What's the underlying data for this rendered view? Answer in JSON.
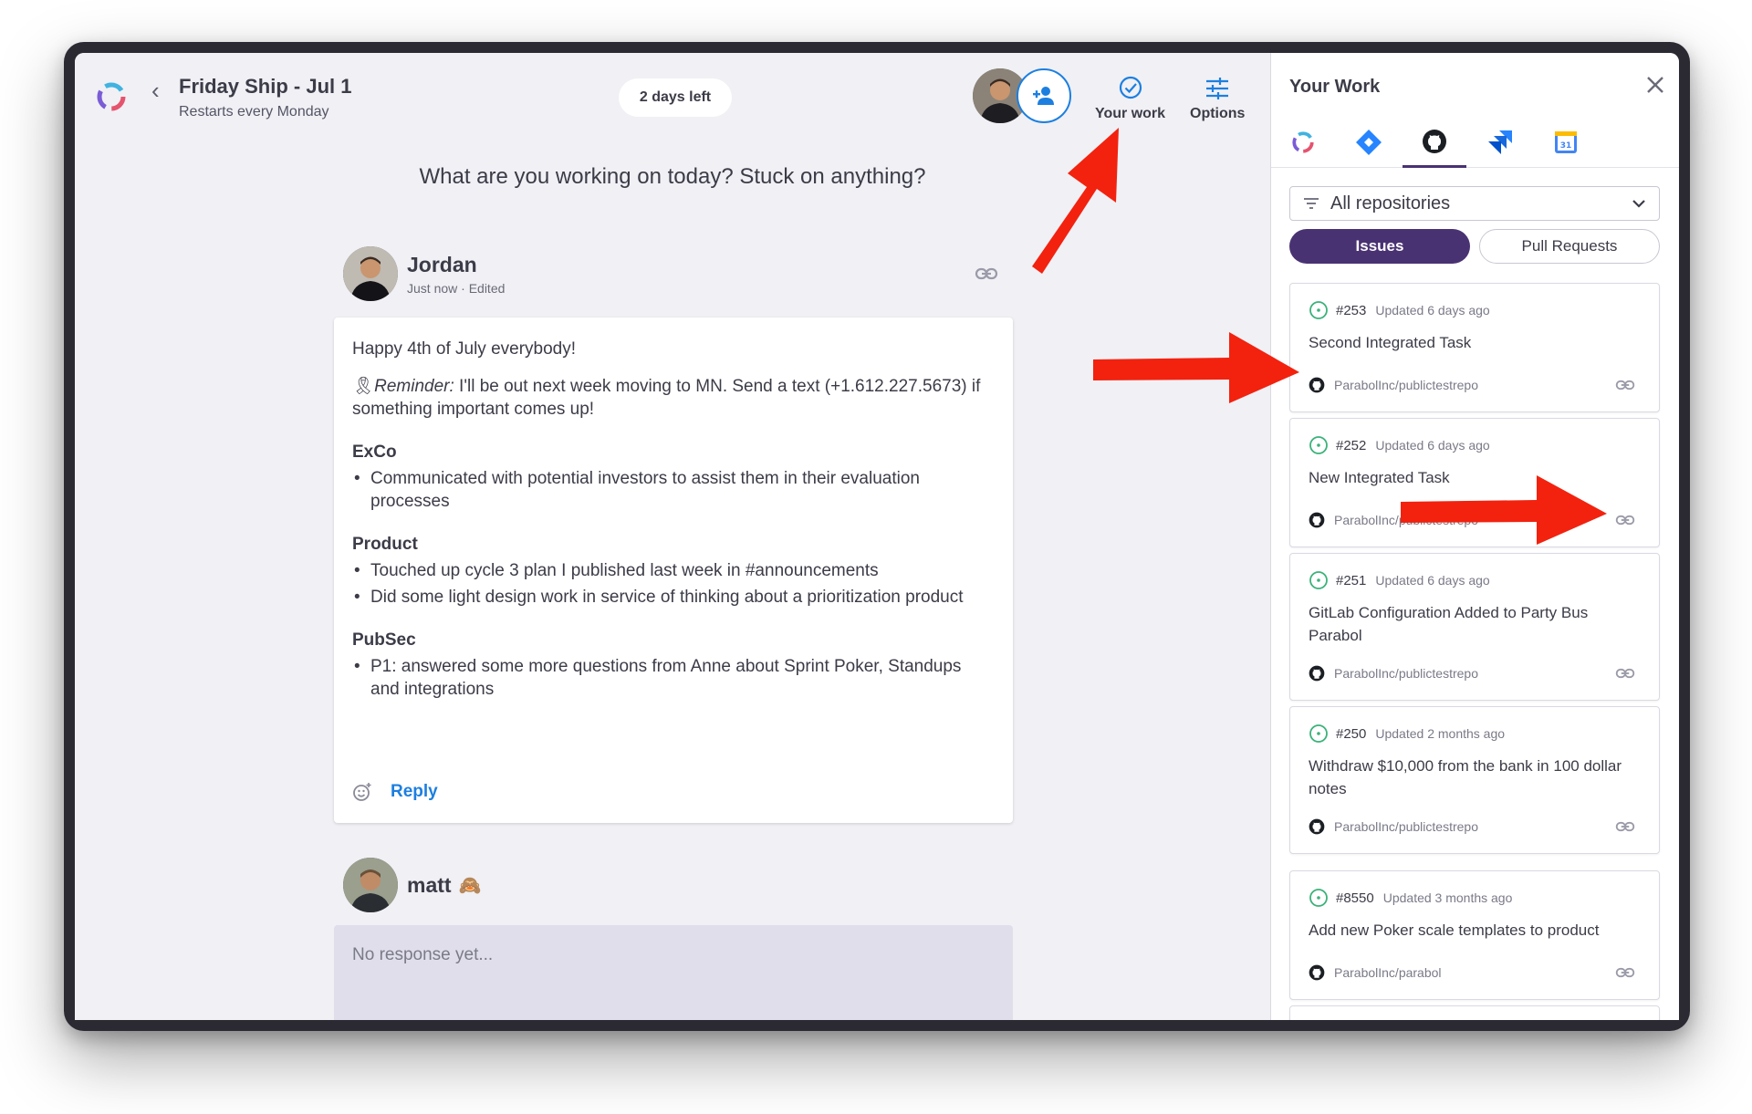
{
  "header": {
    "meeting_title": "Friday Ship - Jul 1",
    "meeting_subtitle": "Restarts every Monday",
    "days_left": "2 days left",
    "your_work_label": "Your work",
    "options_label": "Options"
  },
  "prompt": "What are you working on today? Stuck on anything?",
  "responses": [
    {
      "name": "Jordan",
      "meta": "Just now · Edited",
      "greeting": "Happy 4th of July everybody!",
      "reminder_emoji": "🎗",
      "reminder_label": "Reminder:",
      "reminder_text": " I'll be out next week moving to MN. Send a text (+1.612.227.5673) if something important comes up!",
      "sections": [
        {
          "heading": "ExCo",
          "items": [
            "Communicated with potential investors to assist them in their evaluation processes"
          ]
        },
        {
          "heading": "Product",
          "items": [
            "Touched up cycle 3 plan I published last week in #announcements",
            "Did some light design work in service of thinking about a prioritization product"
          ]
        },
        {
          "heading": "PubSec",
          "items": [
            "P1: answered some more questions from Anne about Sprint Poker, Standups and integrations"
          ]
        }
      ],
      "reply_label": "Reply"
    },
    {
      "name": "matt",
      "name_emoji": "🙈",
      "empty_text": "No response yet..."
    }
  ],
  "panel": {
    "title": "Your Work",
    "repo_filter": "All repositories",
    "segment_issues": "Issues",
    "segment_prs": "Pull Requests",
    "issues": [
      {
        "number": "#253",
        "updated": "Updated 6 days ago",
        "title": "Second Integrated Task",
        "repo": "ParabolInc/publictestrepo"
      },
      {
        "number": "#252",
        "updated": "Updated 6 days ago",
        "title": "New Integrated Task",
        "repo": "ParabolInc/publictestrepo"
      },
      {
        "number": "#251",
        "updated": "Updated 6 days ago",
        "title": "GitLab Configuration Added to Party Bus Parabol",
        "repo": "ParabolInc/publictestrepo"
      },
      {
        "number": "#250",
        "updated": "Updated 2 months ago",
        "title": "Withdraw $10,000 from the bank in 100 dollar notes",
        "repo": "ParabolInc/publictestrepo"
      },
      {
        "number": "#8550",
        "updated": "Updated 3 months ago",
        "title": "Add new Poker scale templates to product",
        "repo": "ParabolInc/parabol"
      }
    ]
  },
  "colors": {
    "brand_purple": "#493272",
    "link_blue": "#1c7fe0",
    "annotation_red": "#f2220f",
    "issue_open_green": "#3bb27a"
  }
}
